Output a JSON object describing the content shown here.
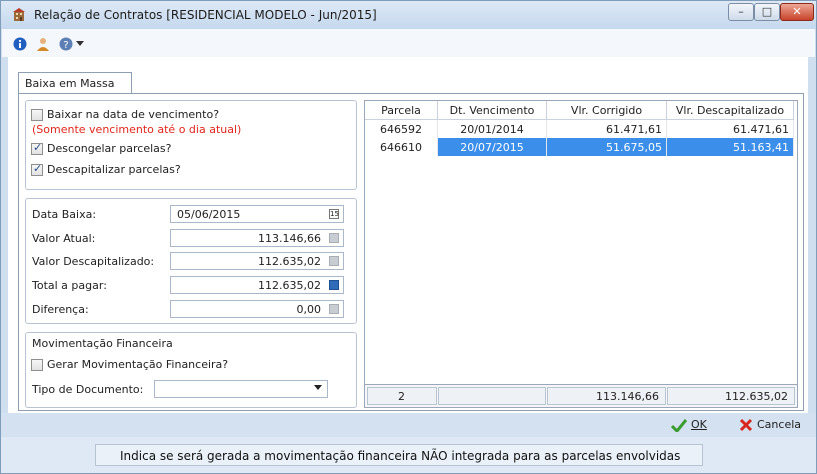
{
  "window": {
    "title": "Relação de Contratos [RESIDENCIAL MODELO - Jun/2015]"
  },
  "tabs": [
    {
      "label": "Baixa em Massa",
      "active": true
    }
  ],
  "options": {
    "baixar_data_vencimento": {
      "label": "Baixar na data de vencimento?",
      "checked": false
    },
    "note": "(Somente vencimento até o dia atual)",
    "descongelar": {
      "label": "Descongelar parcelas?",
      "checked": true
    },
    "descapitalizar": {
      "label": "Descapitalizar parcelas?",
      "checked": true
    }
  },
  "form": {
    "data_baixa": {
      "label": "Data Baixa:",
      "value": "05/06/2015"
    },
    "valor_atual": {
      "label": "Valor Atual:",
      "value": "113.146,66"
    },
    "valor_descapitalizado": {
      "label": "Valor Descapitalizado:",
      "value": "112.635,02"
    },
    "total_pagar": {
      "label": "Total a pagar:",
      "value": "112.635,02"
    },
    "diferenca": {
      "label": "Diferença:",
      "value": "0,00"
    }
  },
  "movimentacao": {
    "group_label": "Movimentação Financeira",
    "gerar": {
      "label": "Gerar Movimentação Financeira?",
      "checked": false
    },
    "tipo_documento": {
      "label": "Tipo de Documento:",
      "value": ""
    }
  },
  "grid": {
    "columns": [
      "Parcela",
      "Dt. Vencimento",
      "Vlr. Corrigido",
      "Vlr. Descapitalizado"
    ],
    "rows": [
      {
        "parcela": "646592",
        "vencimento": "20/01/2014",
        "corrigido": "61.471,61",
        "descapitalizado": "61.471,61",
        "selected": false
      },
      {
        "parcela": "646610",
        "vencimento": "20/07/2015",
        "corrigido": "51.675,05",
        "descapitalizado": "51.163,41",
        "selected": true
      }
    ],
    "footer": {
      "count": "2",
      "vencimento": "",
      "total_corrigido": "113.146,66",
      "total_descapitalizado": "112.635,02"
    }
  },
  "buttons": {
    "ok": "OK",
    "cancel": "Cancela"
  },
  "status": {
    "text": "Indica se será gerada a movimentação financeira NÃO integrada para as parcelas envolvidas"
  },
  "colors": {
    "selection": "#3b8ee9",
    "accent_red": "#e0261c",
    "ok_green": "#3a9c2e",
    "cancel_red": "#d9261c"
  }
}
